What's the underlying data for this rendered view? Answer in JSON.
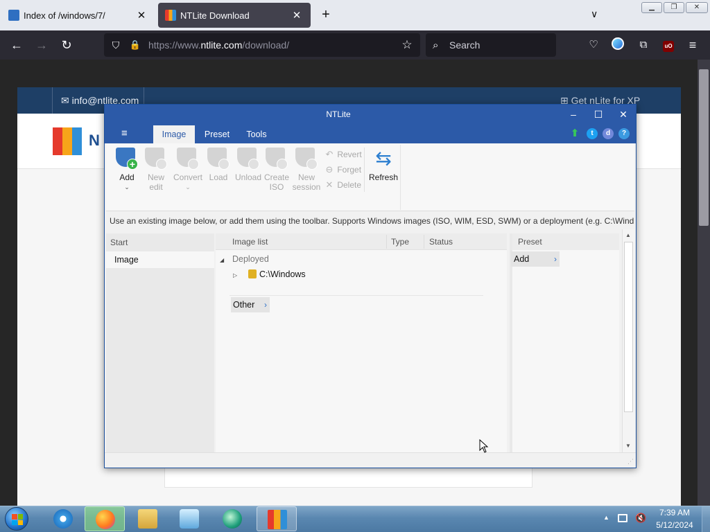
{
  "browser": {
    "tabs": [
      {
        "title": "Index of /windows/7/",
        "active": false
      },
      {
        "title": "NTLite Download",
        "active": true
      }
    ],
    "url_prefix": "https://www.",
    "url_host": "ntlite.com",
    "url_path": "/download/",
    "search_placeholder": "Search",
    "icons": {
      "back": "←",
      "forward": "→",
      "reload": "↻",
      "shield": "⛉",
      "lock": "🔒",
      "star": "☆",
      "search": "⌕",
      "pocket": "♡",
      "extensions": "⧉",
      "menu": "≡",
      "ublock": "uO",
      "new_tab": "+",
      "tab_list": "∨",
      "close": "✕",
      "win_min": "▁",
      "win_max": "❐",
      "win_close": "✕"
    }
  },
  "website": {
    "email": "info@ntlite.com",
    "xp_link": "Get nLite for XP",
    "logo_text": "N",
    "email_icon": "✉",
    "windows_icon": "⊞"
  },
  "ntlite": {
    "title": "NTLite",
    "controls": {
      "min": "–",
      "max": "☐",
      "close": "✕"
    },
    "menu_icon": "≡",
    "tabs": [
      "Image",
      "Preset",
      "Tools"
    ],
    "social": {
      "update": "⬆",
      "twitter": "t",
      "discord": "d",
      "help": "?"
    },
    "ribbon": {
      "add": "Add",
      "add_caret": "⌄",
      "new_edit": [
        "New",
        "edit"
      ],
      "convert": "Convert",
      "convert_caret": "⌄",
      "load": "Load",
      "unload": "Unload",
      "create_iso": [
        "Create",
        "ISO"
      ],
      "new_session": [
        "New",
        "session"
      ],
      "revert": "Revert",
      "forget": "Forget",
      "delete": "Delete",
      "refresh": "Refresh",
      "icons": {
        "revert": "↶",
        "forget": "⊖",
        "delete": "✕",
        "refresh": "⇆",
        "add_plus": "+"
      }
    },
    "info_text": "Use an existing image below, or add them using the toolbar. Supports Windows images (ISO, WIM, ESD, SWM) or a deployment (e.g. C:\\Wind...",
    "start": {
      "header": "Start",
      "item": "Image"
    },
    "image_list": {
      "columns": [
        "Image list",
        "Type",
        "Status"
      ],
      "groups": [
        {
          "label": "Deployed",
          "expanded_icon": "◢",
          "items": [
            {
              "label": "C:\\Windows",
              "expander": "▷"
            }
          ]
        }
      ],
      "other_button": "Other",
      "chevron": "›"
    },
    "preset": {
      "header": "Preset",
      "add_button": "Add",
      "chevron": "›"
    },
    "scroll": {
      "up": "▲",
      "down": "▼"
    },
    "grip": "⋰"
  },
  "taskbar": {
    "time": "7:39 AM",
    "date": "5/12/2024",
    "tray_arrow": "▲",
    "volume_icon": "🔇"
  }
}
